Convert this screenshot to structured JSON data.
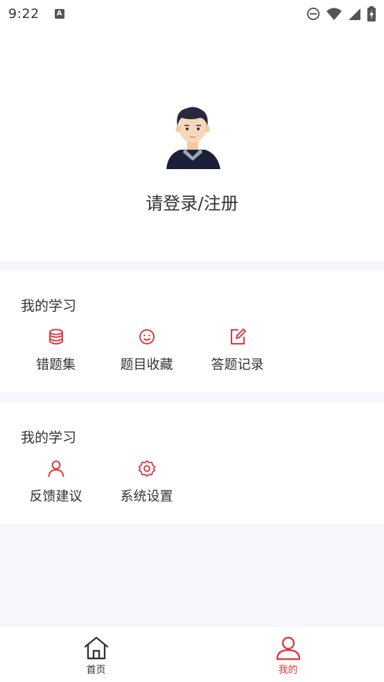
{
  "status_bar": {
    "time": "9:22",
    "notification_icon": "a-icon",
    "icons": [
      "dnd-icon",
      "wifi-icon",
      "signal-icon",
      "battery-icon"
    ]
  },
  "profile": {
    "avatar_icon": "avatar-icon",
    "login_text": "请登录/注册"
  },
  "sections": [
    {
      "title": "我的学习",
      "items": [
        {
          "label": "错题集",
          "icon": "database-icon"
        },
        {
          "label": "题目收藏",
          "icon": "smiley-icon"
        },
        {
          "label": "答题记录",
          "icon": "edit-icon"
        }
      ]
    },
    {
      "title": "我的学习",
      "items": [
        {
          "label": "反馈建议",
          "icon": "user-icon"
        },
        {
          "label": "系统设置",
          "icon": "settings-icon"
        }
      ]
    }
  ],
  "bottom_nav": {
    "items": [
      {
        "label": "首页",
        "icon": "home-icon",
        "active": false
      },
      {
        "label": "我的",
        "icon": "user-icon",
        "active": true
      }
    ]
  },
  "colors": {
    "accent": "#e0383e",
    "background": "#f5f7fc",
    "text": "#333333"
  }
}
